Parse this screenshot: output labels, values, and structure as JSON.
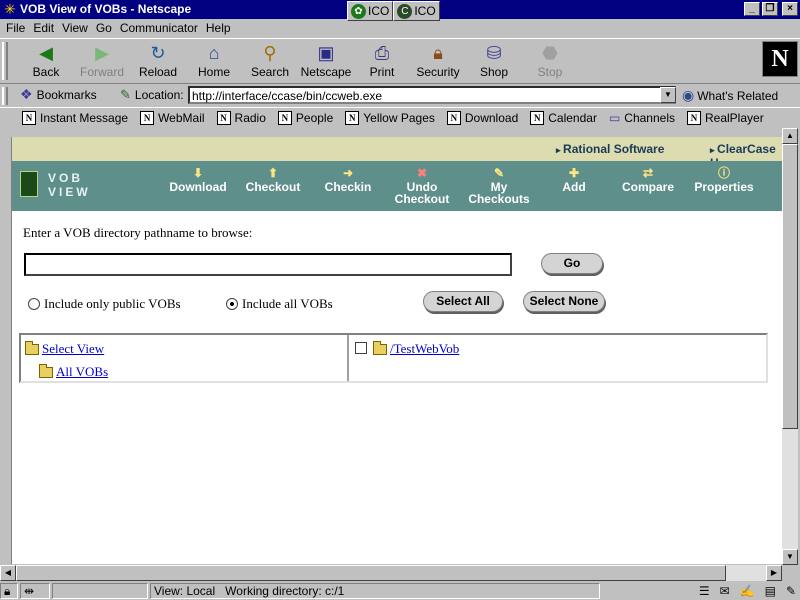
{
  "window": {
    "title": "VOB View of VOBs - Netscape",
    "taskbar": [
      {
        "label": "ICO"
      },
      {
        "label": "ICO"
      }
    ]
  },
  "menu": [
    "File",
    "Edit",
    "View",
    "Go",
    "Communicator",
    "Help"
  ],
  "nav_toolbar": [
    {
      "label": "Back",
      "icon": "back-arrow-icon",
      "enabled": true
    },
    {
      "label": "Forward",
      "icon": "forward-arrow-icon",
      "enabled": false
    },
    {
      "label": "Reload",
      "icon": "reload-icon",
      "enabled": true
    },
    {
      "label": "Home",
      "icon": "home-icon",
      "enabled": true
    },
    {
      "label": "Search",
      "icon": "search-icon",
      "enabled": true
    },
    {
      "label": "Netscape",
      "icon": "netscape-icon",
      "enabled": true
    },
    {
      "label": "Print",
      "icon": "print-icon",
      "enabled": true
    },
    {
      "label": "Security",
      "icon": "lock-icon",
      "enabled": true
    },
    {
      "label": "Shop",
      "icon": "shop-icon",
      "enabled": true
    },
    {
      "label": "Stop",
      "icon": "stop-icon",
      "enabled": false
    }
  ],
  "location": {
    "bookmarks_label": "Bookmarks",
    "location_label": "Location:",
    "url": "http://interface/ccase/bin/ccweb.exe",
    "whats_related": "What's Related"
  },
  "personal_toolbar": [
    "Instant Message",
    "WebMail",
    "Radio",
    "People",
    "Yellow Pages",
    "Download",
    "Calendar",
    "Channels",
    "RealPlayer"
  ],
  "page": {
    "top_links": [
      "Rational Software",
      "ClearCase H"
    ],
    "logo_text": "VOB VIEW",
    "actions": [
      {
        "label": "Download",
        "icon": "download-icon"
      },
      {
        "label": "Checkout",
        "icon": "checkout-icon"
      },
      {
        "label": "Checkin",
        "icon": "checkin-icon"
      },
      {
        "label": "Undo Checkout",
        "icon": "undo-checkout-icon"
      },
      {
        "label": "My Checkouts",
        "icon": "my-checkouts-icon"
      },
      {
        "label": "Add",
        "icon": "add-icon"
      },
      {
        "label": "Compare",
        "icon": "compare-icon"
      },
      {
        "label": "Properties",
        "icon": "properties-icon"
      }
    ],
    "prompt": "Enter a VOB directory pathname to browse:",
    "path_value": "",
    "go_label": "Go",
    "radio_public": "Include only public VOBs",
    "radio_all": "Include all VOBs",
    "radio_selected": "all",
    "select_all": "Select All",
    "select_none": "Select None",
    "tree": {
      "select_view": "Select View",
      "all_vobs": "All VOBs"
    },
    "vobs": [
      "/TestWebVob"
    ]
  },
  "status": {
    "view": "View: Local",
    "workdir": "Working directory: c:/1"
  }
}
